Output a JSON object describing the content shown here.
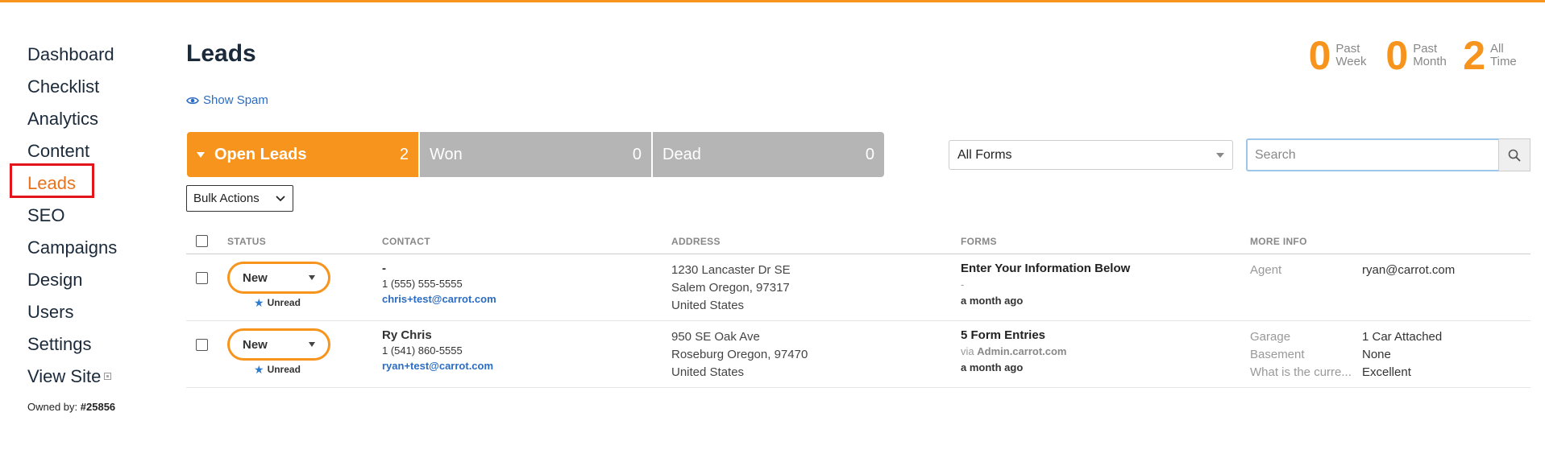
{
  "accent_color": "#f7941d",
  "sidebar": {
    "items": [
      {
        "label": "Dashboard"
      },
      {
        "label": "Checklist"
      },
      {
        "label": "Analytics"
      },
      {
        "label": "Content"
      },
      {
        "label": "Leads",
        "active": true
      },
      {
        "label": "SEO"
      },
      {
        "label": "Campaigns"
      },
      {
        "label": "Design"
      },
      {
        "label": "Users"
      },
      {
        "label": "Settings"
      },
      {
        "label": "View Site",
        "icon": "external-link-icon"
      }
    ],
    "owned_label": "Owned by:",
    "owned_value": "#25856"
  },
  "header": {
    "title": "Leads",
    "show_spam": "Show Spam"
  },
  "stats": [
    {
      "value": "0",
      "label_line1": "Past",
      "label_line2": "Week"
    },
    {
      "value": "0",
      "label_line1": "Past",
      "label_line2": "Month"
    },
    {
      "value": "2",
      "label_line1": "All",
      "label_line2": "Time"
    }
  ],
  "tabs": [
    {
      "label": "Open Leads",
      "count": "2"
    },
    {
      "label": "Won",
      "count": "0"
    },
    {
      "label": "Dead",
      "count": "0"
    }
  ],
  "filters": {
    "forms_selected": "All Forms",
    "search_placeholder": "Search",
    "bulk_actions": "Bulk Actions"
  },
  "table": {
    "headers": {
      "status": "STATUS",
      "contact": "CONTACT",
      "address": "ADDRESS",
      "forms": "FORMS",
      "more_info": "MORE INFO"
    },
    "rows": [
      {
        "status": "New",
        "unread": "Unread",
        "contact_name": "-",
        "contact_phone": "1 (555) 555-5555",
        "contact_email": "chris+test@carrot.com",
        "address_line1": "1230 Lancaster Dr SE",
        "address_line2": "Salem Oregon, 97317",
        "address_line3": "United States",
        "form_title": "Enter Your Information Below",
        "form_sub": "-",
        "form_time": "a month ago",
        "more_info": [
          {
            "key": "Agent",
            "value": "ryan@carrot.com"
          }
        ]
      },
      {
        "status": "New",
        "unread": "Unread",
        "contact_name": "Ry Chris",
        "contact_phone": "1 (541) 860-5555",
        "contact_email": "ryan+test@carrot.com",
        "address_line1": "950 SE Oak Ave",
        "address_line2": "Roseburg Oregon, 97470",
        "address_line3": "United States",
        "form_title": "5 Form Entries",
        "form_sub_prefix": "via",
        "form_sub": "Admin.carrot.com",
        "form_time": "a month ago",
        "more_info": [
          {
            "key": "Garage",
            "value": "1 Car Attached"
          },
          {
            "key": "Basement",
            "value": "None"
          },
          {
            "key": "What is the curre...",
            "value": "Excellent"
          }
        ]
      }
    ]
  }
}
